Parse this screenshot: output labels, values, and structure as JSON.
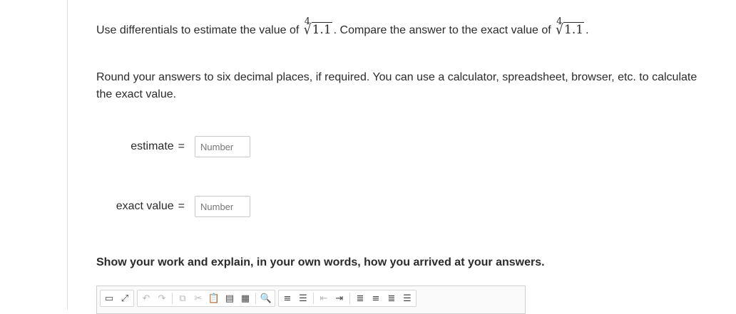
{
  "question": {
    "intro": "Use differentials to estimate the value of",
    "compare": ". Compare the answer to the exact value of",
    "end": ".",
    "radical_index": "4",
    "radicand": "1.1",
    "radical_symbol": "√",
    "rounding": "Round your answers to six decimal places, if required. You can use a calculator, spreadsheet, browser, etc. to calculate the exact value."
  },
  "fields": [
    {
      "label": "estimate",
      "equals": "=",
      "placeholder": "Number",
      "value": ""
    },
    {
      "label": "exact value",
      "equals": "=",
      "placeholder": "Number",
      "value": ""
    }
  ],
  "show_work": "Show your work and explain, in your own words, how you arrived at your answers.",
  "toolbar": {
    "icons": [
      "source-icon",
      "maximize-icon",
      "undo-icon",
      "redo-icon",
      "copy-icon",
      "cut-icon",
      "paste-icon",
      "paste-text-icon",
      "paste-word-icon",
      "find-icon",
      "numbered-list-icon",
      "bulleted-list-icon",
      "outdent-icon",
      "indent-icon",
      "align-left-icon",
      "align-center-icon",
      "align-right-icon",
      "justify-icon"
    ]
  }
}
